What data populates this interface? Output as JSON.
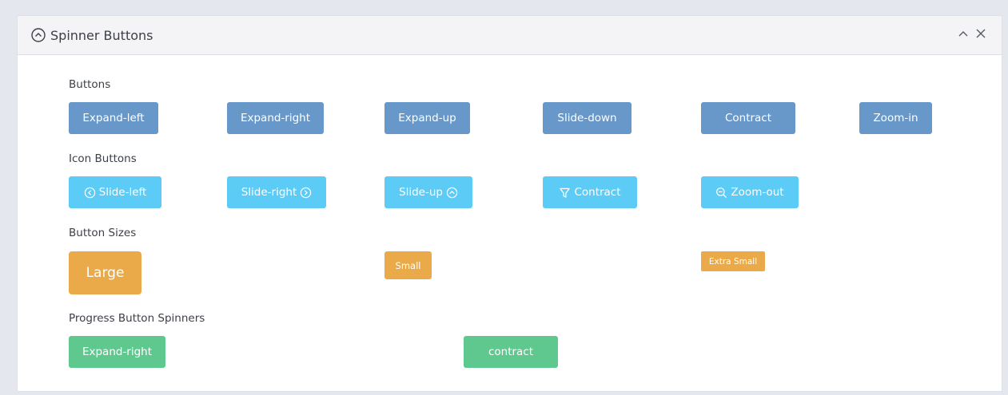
{
  "panel": {
    "title": "Spinner Buttons",
    "title_icon": "chevron-up-circle-icon"
  },
  "header_controls": {
    "collapse_icon": "chevron-up-icon",
    "close_icon": "close-icon"
  },
  "sections": {
    "buttons": {
      "label": "Buttons",
      "items": [
        "Expand-left",
        "Expand-right",
        "Expand-up",
        "Slide-down",
        "Contract",
        "Zoom-in"
      ]
    },
    "icon_buttons": {
      "label": "Icon Buttons",
      "items": [
        {
          "label": "Slide-left",
          "icon": "chevron-left-circle-icon"
        },
        {
          "label": "Slide-right",
          "icon": "chevron-right-circle-icon"
        },
        {
          "label": "Slide-up",
          "icon": "chevron-up-circle-icon"
        },
        {
          "label": "Contract",
          "icon": "filter-icon"
        },
        {
          "label": "Zoom-out",
          "icon": "zoom-out-icon"
        }
      ]
    },
    "button_sizes": {
      "label": "Button Sizes",
      "items": [
        "Large",
        "Small",
        "Extra Small"
      ]
    },
    "progress": {
      "label": "Progress Button Spinners",
      "items": [
        "Expand-right",
        "contract"
      ]
    }
  },
  "colors": {
    "primary": "#6798c9",
    "info": "#5ccbf5",
    "warning": "#eaaa4a",
    "success": "#5fc88f"
  }
}
